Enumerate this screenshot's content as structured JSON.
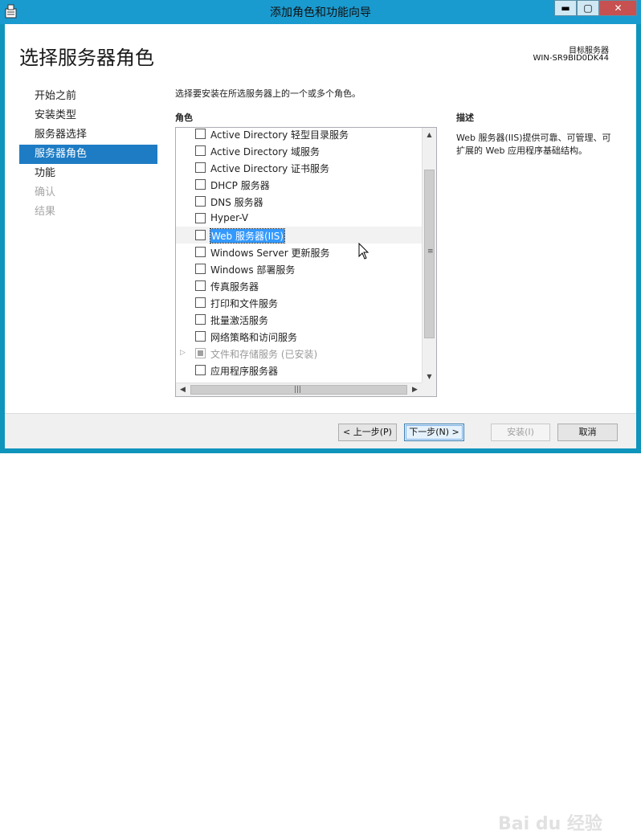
{
  "window": {
    "title": "添加角色和功能向导",
    "controls": {
      "minimize": "▬",
      "maximize": "▢",
      "close": "✕"
    }
  },
  "header": {
    "page_title": "选择服务器角色",
    "destination_label": "目标服务器",
    "destination_value": "WIN-SR9BID0DK44"
  },
  "nav": {
    "items": [
      {
        "label": "开始之前",
        "state": "normal"
      },
      {
        "label": "安装类型",
        "state": "normal"
      },
      {
        "label": "服务器选择",
        "state": "normal"
      },
      {
        "label": "服务器角色",
        "state": "active"
      },
      {
        "label": "功能",
        "state": "normal"
      },
      {
        "label": "确认",
        "state": "disabled"
      },
      {
        "label": "结果",
        "state": "disabled"
      }
    ]
  },
  "main": {
    "instruction": "选择要安装在所选服务器上的一个或多个角色。",
    "roles_heading": "角色",
    "roles": [
      {
        "label": "Active Directory 轻型目录服务",
        "checked": false
      },
      {
        "label": "Active Directory 域服务",
        "checked": false
      },
      {
        "label": "Active Directory 证书服务",
        "checked": false
      },
      {
        "label": "DHCP 服务器",
        "checked": false
      },
      {
        "label": "DNS 服务器",
        "checked": false
      },
      {
        "label": "Hyper-V",
        "checked": false
      },
      {
        "label": "Web 服务器(IIS)",
        "checked": false,
        "selected": true
      },
      {
        "label": "Windows Server 更新服务",
        "checked": false
      },
      {
        "label": "Windows 部署服务",
        "checked": false
      },
      {
        "label": "传真服务器",
        "checked": false
      },
      {
        "label": "打印和文件服务",
        "checked": false
      },
      {
        "label": "批量激活服务",
        "checked": false
      },
      {
        "label": "网络策略和访问服务",
        "checked": false
      },
      {
        "label": "文件和存储服务 (已安装)",
        "checked": "partial",
        "disabled": true,
        "expandable": true
      },
      {
        "label": "应用程序服务器",
        "checked": false
      }
    ]
  },
  "description": {
    "heading": "描述",
    "text": "Web 服务器(IIS)提供可靠、可管理、可扩展的 Web 应用程序基础结构。"
  },
  "footer": {
    "prev": "< 上一步(P)",
    "next": "下一步(N) >",
    "install": "安装(I)",
    "cancel": "取消"
  },
  "watermark": "Bai du 经验"
}
